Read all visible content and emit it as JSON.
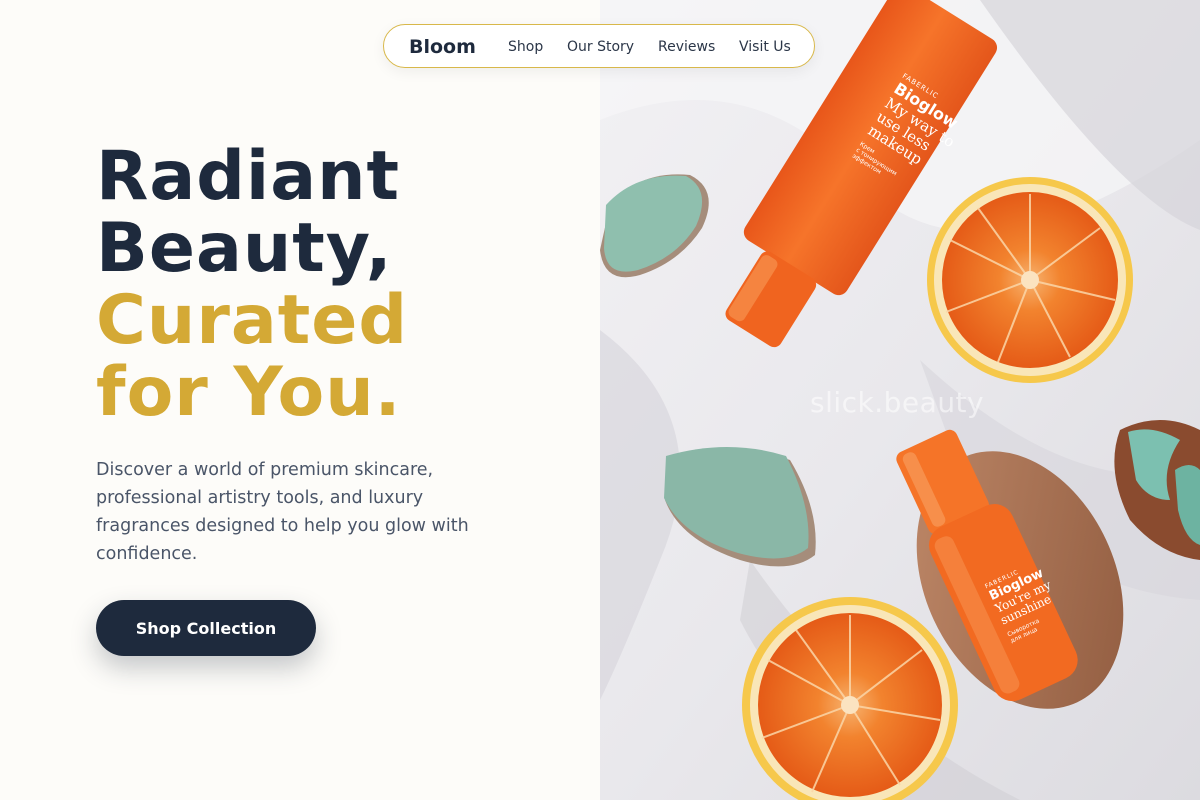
{
  "nav": {
    "brand": "Bloom",
    "links": [
      "Shop",
      "Our Story",
      "Reviews",
      "Visit Us"
    ]
  },
  "hero": {
    "headline_dark": [
      "Radiant",
      "Beauty,"
    ],
    "headline_accent": [
      "Curated",
      "for You."
    ],
    "description": "Discover a world of premium skincare, professional artistry tools, and luxury fragrances designed to help you glow with confidence.",
    "cta_label": "Shop Collection"
  },
  "image": {
    "watermark": "slick.beauty",
    "tube": {
      "brand": "FABERLIC",
      "product": "Bioglow",
      "tagline_lines": [
        "My way to",
        "use less",
        "makeup"
      ],
      "small_lines": [
        "Крем",
        "с тонирующим",
        "эффектом"
      ]
    },
    "bottle": {
      "brand": "FABERLIC",
      "product": "Bioglow",
      "tagline_lines": [
        "You're my",
        "sunshine"
      ],
      "small_lines": [
        "Сыворотка",
        "для лица"
      ]
    }
  },
  "colors": {
    "navy": "#1e2a3d",
    "gold": "#d4a935",
    "text_muted": "#4a5568",
    "background": "#fdfcf9",
    "nav_border": "#d8b84a",
    "product_orange": "#f26a21"
  }
}
